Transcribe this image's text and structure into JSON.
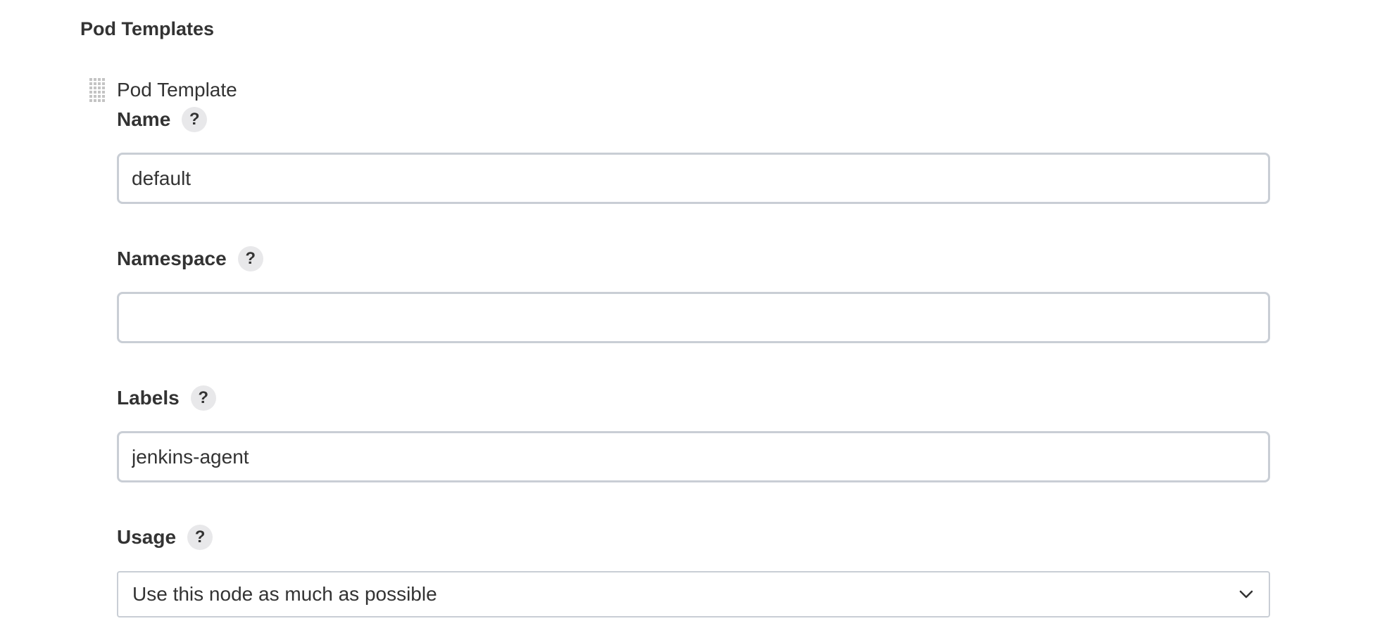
{
  "section": {
    "title": "Pod Templates"
  },
  "pod_template": {
    "title": "Pod Template",
    "fields": {
      "name": {
        "label": "Name",
        "value": "default",
        "help": "?"
      },
      "namespace": {
        "label": "Namespace",
        "value": "",
        "help": "?"
      },
      "labels": {
        "label": "Labels",
        "value": "jenkins-agent",
        "help": "?"
      },
      "usage": {
        "label": "Usage",
        "selected": "Use this node as much as possible",
        "help": "?"
      }
    }
  },
  "colors": {
    "text": "#333333",
    "input_border": "#c9ced5",
    "help_bg": "#e8e8ea",
    "handle_dots": "#c4c4c4"
  }
}
